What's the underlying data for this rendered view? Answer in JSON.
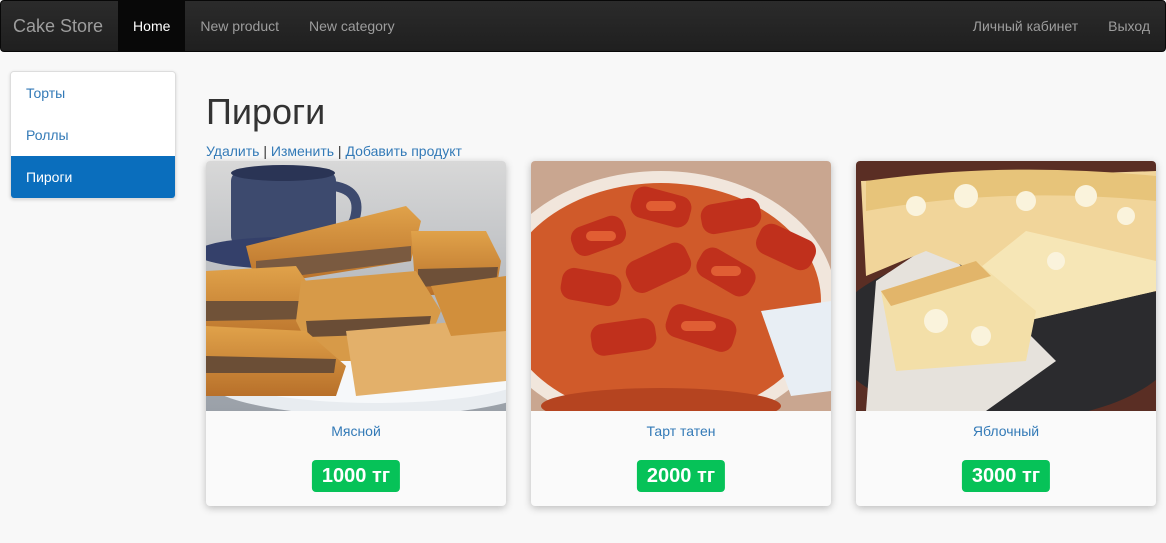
{
  "navbar": {
    "brand": "Cake Store",
    "links": [
      "Home",
      "New product",
      "New category"
    ],
    "right_links": [
      "Личный кабинет",
      "Выход"
    ]
  },
  "sidebar": {
    "items": [
      {
        "label": "Торты"
      },
      {
        "label": "Роллы"
      },
      {
        "label": "Пироги"
      }
    ]
  },
  "main": {
    "title": "Пироги",
    "actions": {
      "delete": "Удалить",
      "edit": "Изменить",
      "add": "Добавить продукт",
      "separator": "|"
    },
    "products": [
      {
        "name": "Мясной",
        "price": "1000 тг"
      },
      {
        "name": "Тарт татен",
        "price": "2000 тг"
      },
      {
        "name": "Яблочный",
        "price": "3000 тг"
      }
    ]
  },
  "colors": {
    "accent": "#0a6ebd",
    "price_badge": "#06c258",
    "navbar": "#222222"
  }
}
